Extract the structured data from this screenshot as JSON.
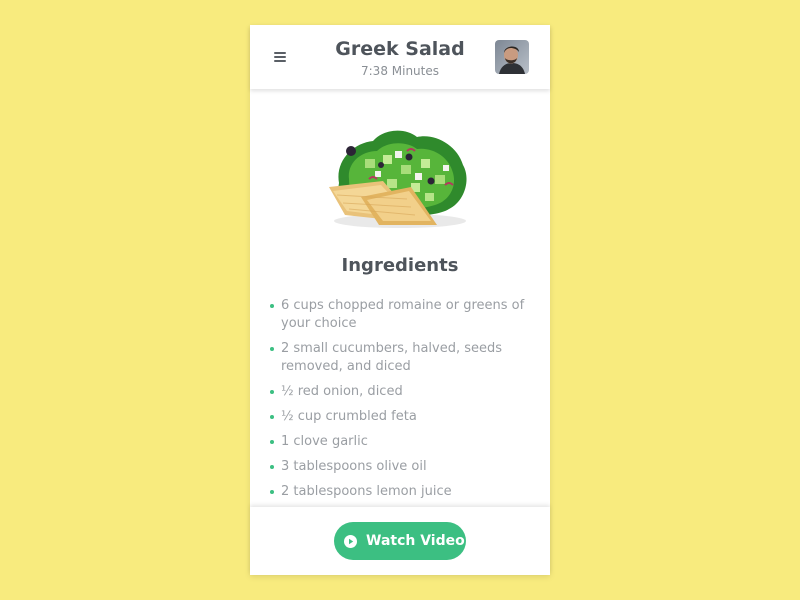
{
  "header": {
    "menu_icon": "hamburger-menu-icon",
    "title": "Greek Salad",
    "subtitle": "7:38 Minutes",
    "avatar_icon": "user-avatar"
  },
  "main": {
    "image_icon": "greek-salad-image",
    "section_title": "Ingredients",
    "ingredients": [
      "6 cups chopped romaine or greens of your choice",
      "2 small cucumbers, halved, seeds removed, and diced",
      "½ red onion, diced",
      "½ cup crumbled feta",
      "1 clove garlic",
      "3 tablespoons olive oil",
      "2 tablespoons lemon juice"
    ]
  },
  "footer": {
    "watch_button_label": "Watch Video",
    "play_icon": "play-circle-icon"
  },
  "colors": {
    "background": "#f8eb7e",
    "accent": "#3cbf82",
    "title_text": "#4e545b",
    "body_text": "#9a9ea3"
  }
}
